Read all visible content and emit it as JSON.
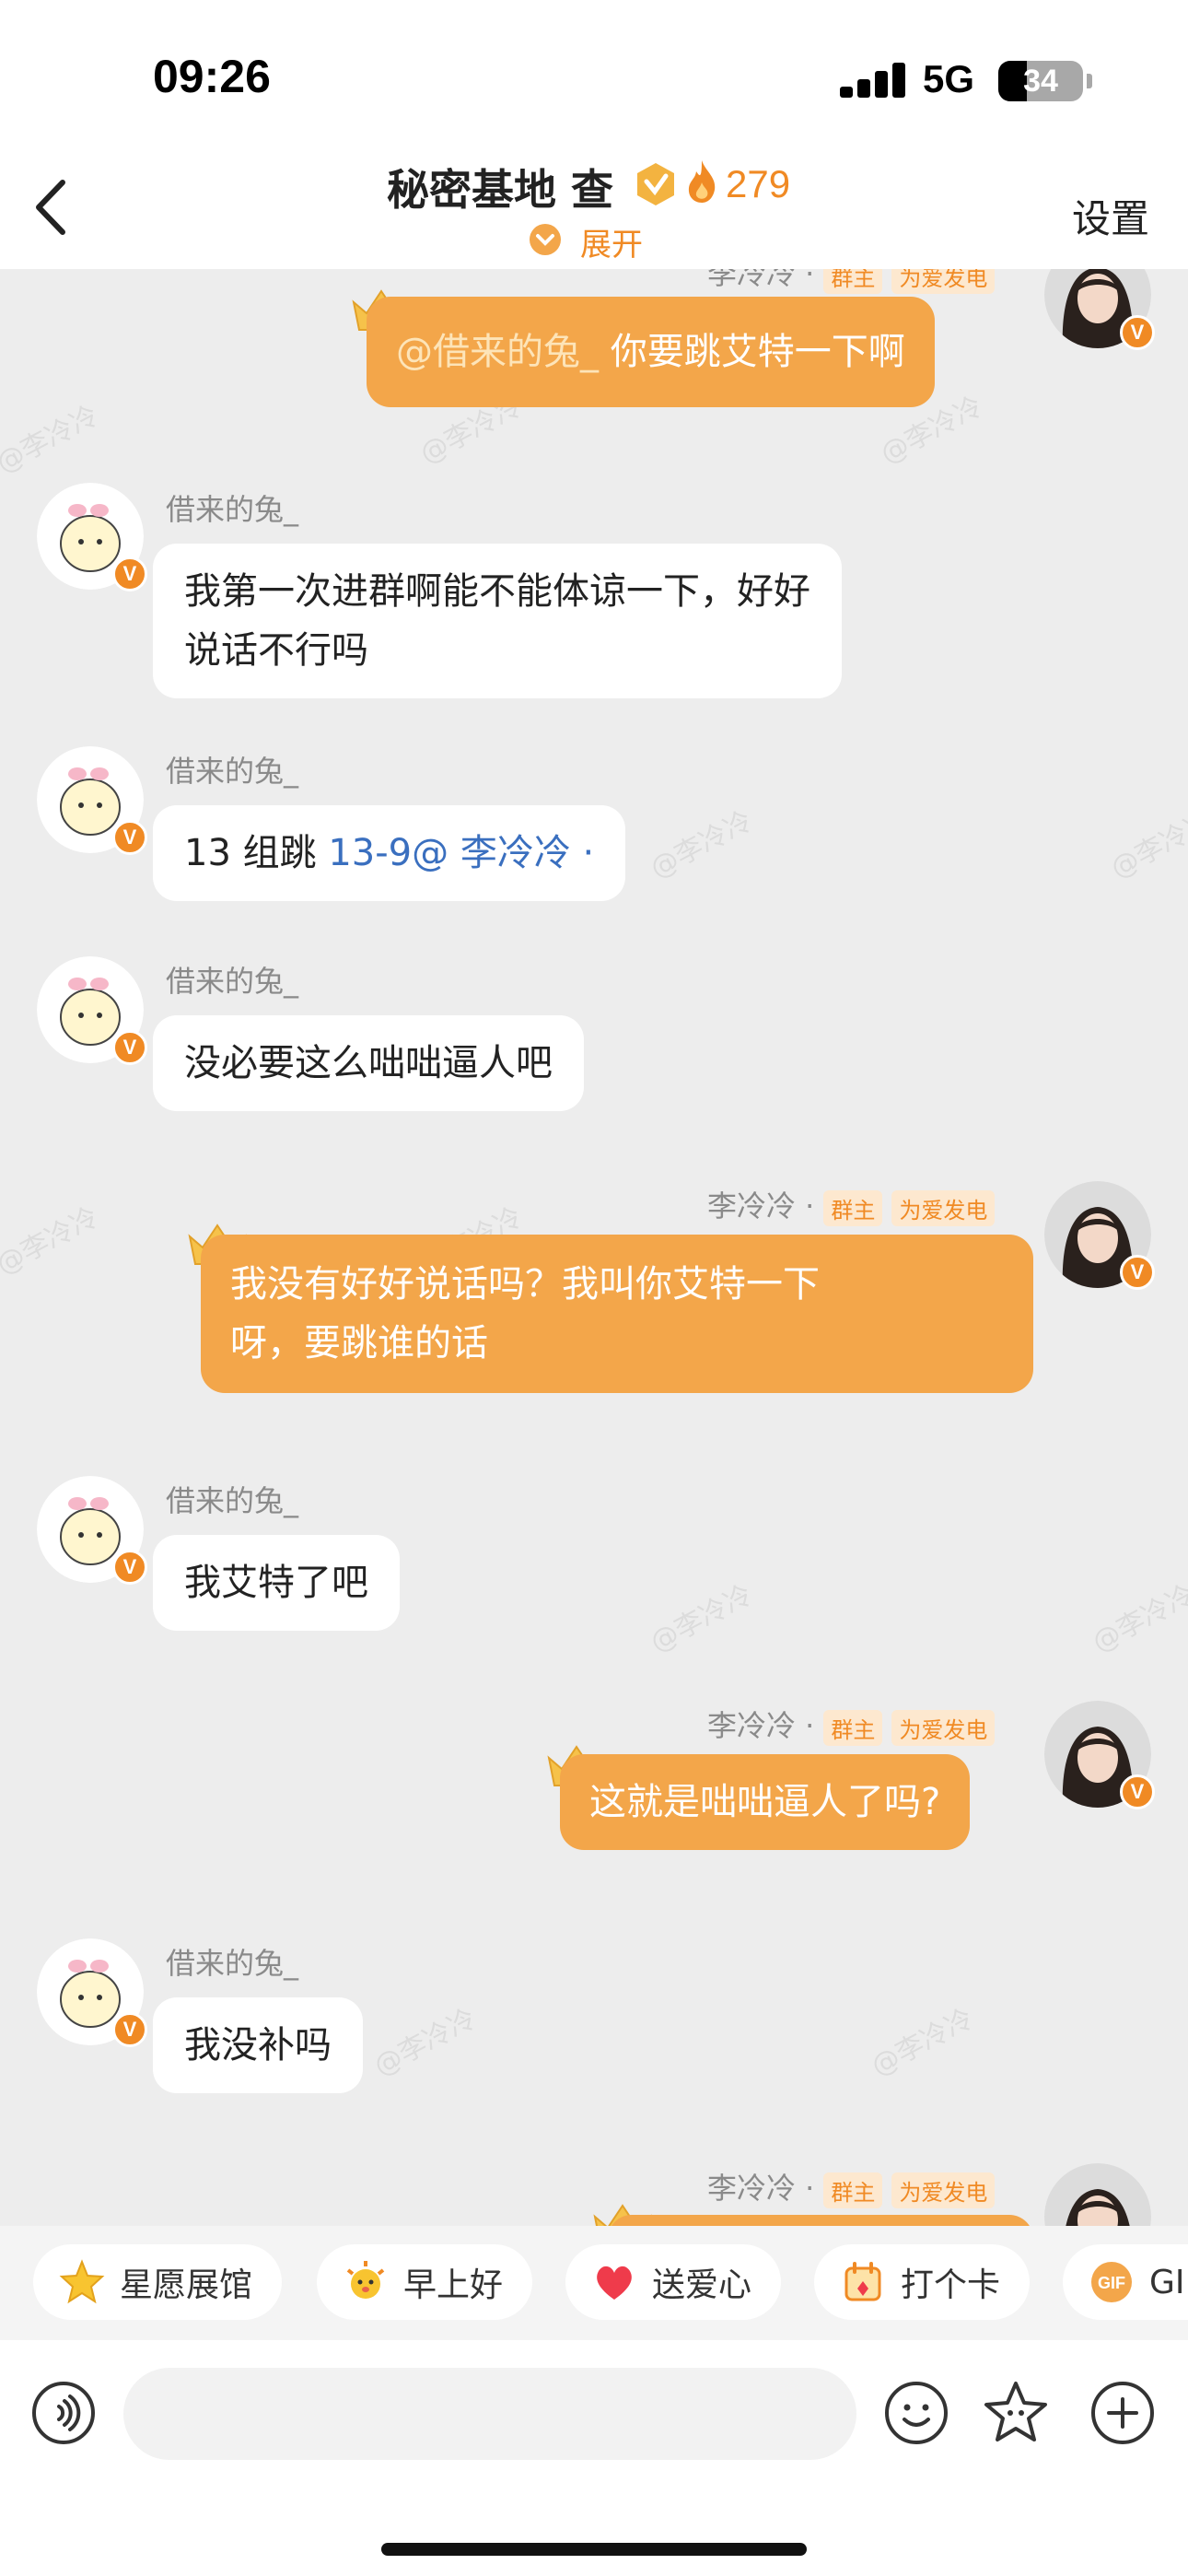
{
  "status_bar": {
    "time": "09:26",
    "network": "5G",
    "battery": "34",
    "battery_level": 0.34
  },
  "header": {
    "title": "秘密基地 查",
    "fire_count": "279",
    "expand_label": "展开",
    "settings_label": "设置"
  },
  "messages": [
    {
      "side": "right",
      "sender": "李冷冷 ·",
      "tags": [
        "群主",
        "为爱发电"
      ],
      "mention": "@借来的兔_",
      "lines": [
        " 你要跳艾特一下啊"
      ]
    },
    {
      "side": "left",
      "sender": "借来的兔_",
      "lines": [
        "我第一次进群啊能不能体谅一下，好好",
        "说话不行吗"
      ]
    },
    {
      "side": "left",
      "sender": "借来的兔_",
      "prefix": "13 组跳 ",
      "link": "13-9@ 李冷冷 ·"
    },
    {
      "side": "left",
      "sender": "借来的兔_",
      "lines": [
        "没必要这么咄咄逼人吧"
      ]
    },
    {
      "side": "right",
      "sender": "李冷冷 ·",
      "tags": [
        "群主",
        "为爱发电"
      ],
      "lines": [
        "我没有好好说话吗？我叫你艾特一下",
        "呀，要跳谁的话"
      ]
    },
    {
      "side": "left",
      "sender": "借来的兔_",
      "lines": [
        "我艾特了吧"
      ]
    },
    {
      "side": "right",
      "sender": "李冷冷 ·",
      "tags": [
        "群主",
        "为爱发电"
      ],
      "lines": [
        "这就是咄咄逼人了吗?"
      ]
    },
    {
      "side": "left",
      "sender": "借来的兔_",
      "lines": [
        "我没补吗"
      ]
    },
    {
      "side": "right",
      "sender": "李冷冷 ·",
      "tags": [
        "群主",
        "为爱发电"
      ],
      "lines": []
    }
  ],
  "watermark": "@李冷冷",
  "quick_actions": [
    {
      "label": "星愿展馆",
      "icon": "star-icon"
    },
    {
      "label": "早上好",
      "icon": "sun-face-icon"
    },
    {
      "label": "送爱心",
      "icon": "heart-icon"
    },
    {
      "label": "打个卡",
      "icon": "calendar-check-icon"
    },
    {
      "label": "GIF",
      "icon": "gif-icon"
    }
  ],
  "input": {
    "placeholder": ""
  },
  "colors": {
    "accent": "#f08a24",
    "bubble_self": "#f3a64a",
    "background": "#ededed"
  }
}
